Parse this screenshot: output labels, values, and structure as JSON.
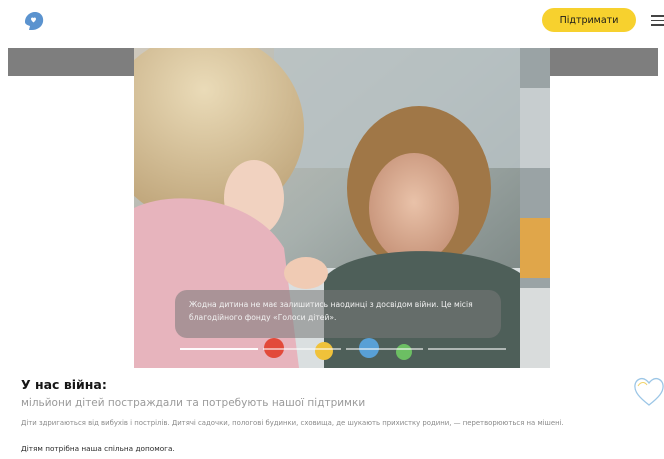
{
  "header": {
    "support_label": "Підтримати",
    "logo_icon": "hand-heart-logo-icon",
    "menu_icon": "hamburger-menu-icon",
    "accent_color": "#f7d12e"
  },
  "hero": {
    "caption": "Жодна дитина не має залишитись наодинці з досвідом війни. Це місія благодійного фонду «Голоси дітей».",
    "slides_total": 4,
    "slide_active": 1
  },
  "intro": {
    "title": "У нас війна:",
    "subtitle": "мільйони дітей постраждали та потребують нашої підтримки",
    "body": "Діти здригаються від вибухів і пострілів. Дитячі садочки, пологові будинки, сховища, де шукають прихистку родини, — перетворюються на мішені.",
    "help": "Дітям потрібна наша спільна допомога.",
    "decor_icon": "heart-outline-icon"
  }
}
